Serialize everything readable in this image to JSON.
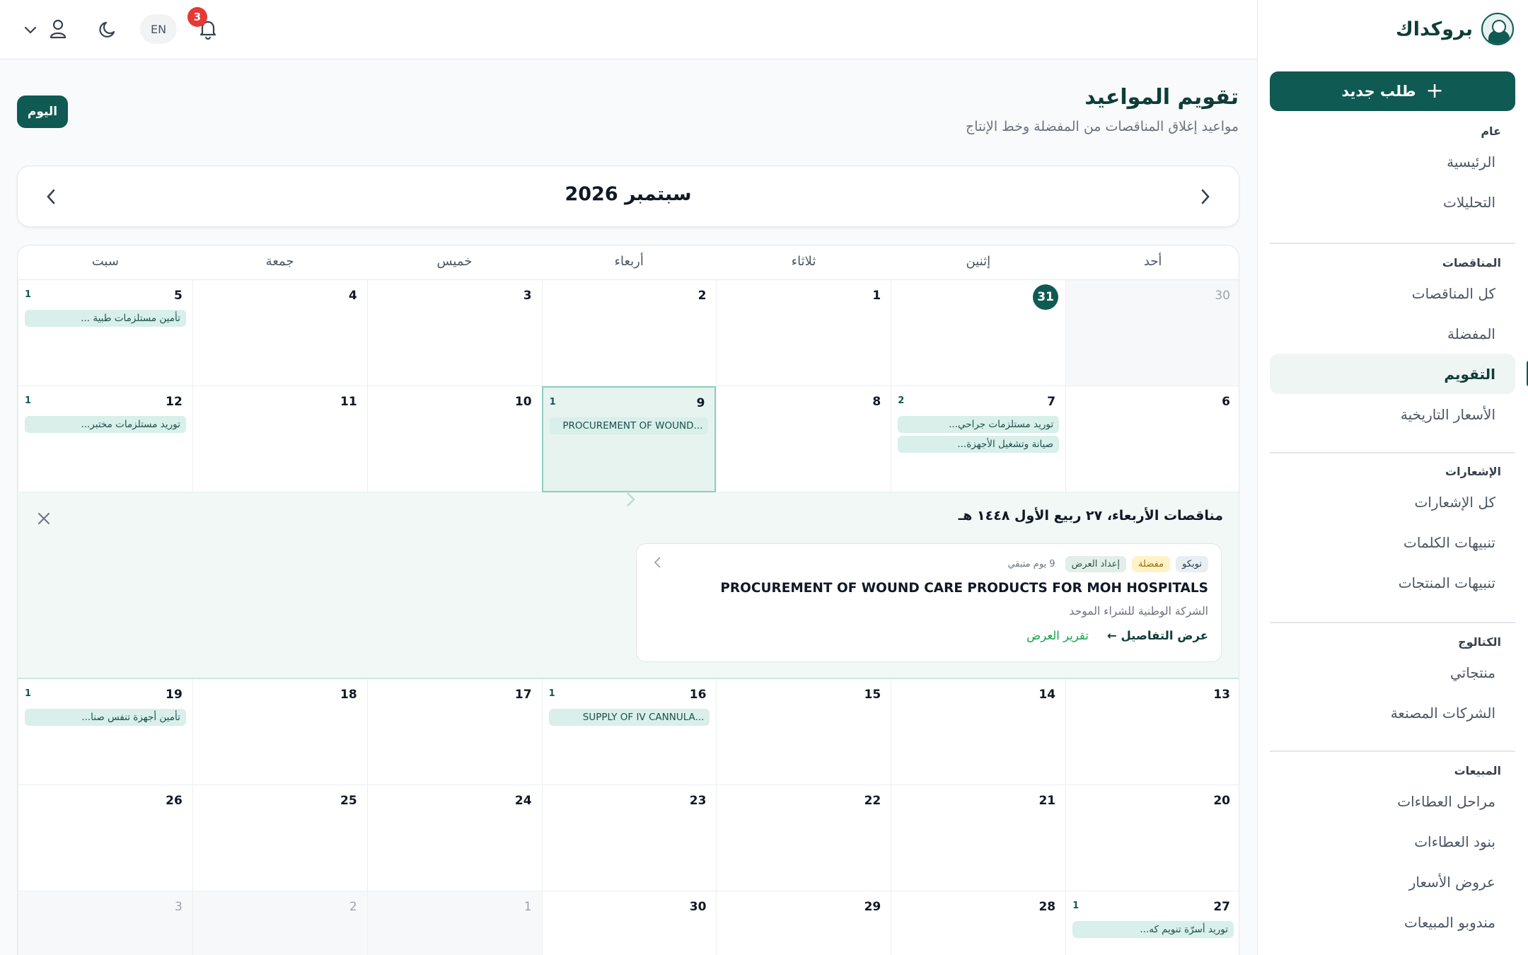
{
  "brand": {
    "name": "بروكداك"
  },
  "sidebar": {
    "new_button": "طلب جديد",
    "sections": [
      {
        "heading": "عام",
        "items": [
          "الرئيسية",
          "التحليلات"
        ]
      },
      {
        "heading": "المناقصات",
        "items": [
          "كل المناقصات",
          "المفضلة",
          "التقويم",
          "الأسعار التاريخية"
        ]
      },
      {
        "heading": "الإشعارات",
        "items": [
          "كل الإشعارات",
          "تنبيهات الكلمات",
          "تنبيهات المنتجات"
        ]
      },
      {
        "heading": "الكتالوج",
        "items": [
          "منتجاتي",
          "الشركات المصنعة"
        ]
      },
      {
        "heading": "المبيعات",
        "items": [
          "مراحل العطاءات",
          "بنود العطاءات",
          "عروض الأسعار",
          "مندوبو المبيعات"
        ]
      }
    ],
    "active_item": "التقويم"
  },
  "topbar": {
    "language": "EN",
    "notifications_count": "3"
  },
  "page": {
    "title": "تقويم المواعيد",
    "subtitle": "مواعيد إغلاق المناقصات من المفضلة وخط الإنتاج",
    "today_button": "اليوم",
    "month_label": "سبتمبر 2026"
  },
  "calendar": {
    "weekdays": [
      "أحد",
      "إثنين",
      "ثلاثاء",
      "أربعاء",
      "خميس",
      "جمعة",
      "سبت"
    ],
    "weeks": [
      [
        {
          "n": "30",
          "muted": true
        },
        {
          "n": "31",
          "today": true
        },
        {
          "n": "1"
        },
        {
          "n": "2"
        },
        {
          "n": "3"
        },
        {
          "n": "4"
        },
        {
          "n": "5",
          "count": "1",
          "events": [
            "تأمين مستلزمات طبية ..."
          ]
        }
      ],
      [
        {
          "n": "6"
        },
        {
          "n": "7",
          "count": "2",
          "events": [
            "توريد مستلزمات جراحي...",
            "صيانة وتشغيل الأجهزة..."
          ]
        },
        {
          "n": "8"
        },
        {
          "n": "9",
          "count": "1",
          "selected": true,
          "events": [
            "PROCUREMENT OF WOUND..."
          ]
        },
        {
          "n": "10"
        },
        {
          "n": "11"
        },
        {
          "n": "12",
          "count": "1",
          "events": [
            "توريد مستلزمات مختبر..."
          ]
        }
      ],
      [
        {
          "n": "13"
        },
        {
          "n": "14"
        },
        {
          "n": "15"
        },
        {
          "n": "16",
          "count": "1",
          "events": [
            "SUPPLY OF IV CANNULA..."
          ]
        },
        {
          "n": "17"
        },
        {
          "n": "18"
        },
        {
          "n": "19",
          "count": "1",
          "events": [
            "تأمين أجهزة تنفس صنا..."
          ]
        }
      ],
      [
        {
          "n": "20"
        },
        {
          "n": "21"
        },
        {
          "n": "22"
        },
        {
          "n": "23"
        },
        {
          "n": "24"
        },
        {
          "n": "25"
        },
        {
          "n": "26"
        }
      ],
      [
        {
          "n": "27",
          "count": "1",
          "events": [
            "توريد أسرّة تنويم كه..."
          ]
        },
        {
          "n": "28"
        },
        {
          "n": "29"
        },
        {
          "n": "30"
        },
        {
          "n": "1",
          "muted": true
        },
        {
          "n": "2",
          "muted": true
        },
        {
          "n": "3",
          "muted": true
        }
      ]
    ]
  },
  "day_panel": {
    "title": "مناقصات الأربعاء، ٢٧ ربيع الأول ١٤٤٨ هـ",
    "tender": {
      "tags": [
        "نوبكو",
        "مفضلة",
        "إعداد العرض"
      ],
      "remaining": "9 يوم متبقي",
      "title": "PROCUREMENT OF WOUND CARE PRODUCTS FOR MOH HOSPITALS",
      "organization": "الشركة الوطنية للشراء الموحد",
      "details_link": "عرض التفاصيل ←",
      "report_link": "تقرير العرض"
    }
  },
  "colors": {
    "brand": "#0f5a52",
    "event_bg": "#d8efea",
    "badge": "#e53935"
  }
}
